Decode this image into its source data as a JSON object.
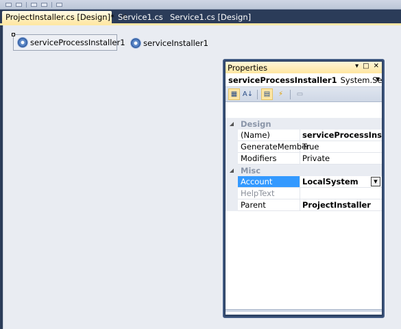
{
  "tabs": [
    {
      "label": "ProjectInstaller.cs [Design]*",
      "active": true
    },
    {
      "label": "Service1.cs",
      "active": false
    },
    {
      "label": "Service1.cs [Design]",
      "active": false
    }
  ],
  "tab_close_glyph": "✕",
  "designer": {
    "components": [
      {
        "label": "serviceProcessInstaller1",
        "icon": "gear-icon",
        "selected": true
      },
      {
        "label": "serviceInstaller1",
        "icon": "gear-icon",
        "selected": false
      }
    ]
  },
  "properties": {
    "title": "Properties",
    "title_buttons": [
      "▾",
      "□",
      "✕"
    ],
    "object_name": "serviceProcessInstaller1",
    "object_type": "System.ServicePro",
    "toolbar": [
      "categorized-icon",
      "alphabetical-icon",
      "properties-icon",
      "events-icon",
      "property-pages-icon"
    ],
    "categories": [
      {
        "name": "Design",
        "rows": [
          {
            "name": "(Name)",
            "value": "serviceProcessInstaller",
            "bold": true
          },
          {
            "name": "GenerateMember",
            "value": "True",
            "bold": false
          },
          {
            "name": "Modifiers",
            "value": "Private",
            "bold": false
          }
        ]
      },
      {
        "name": "Misc",
        "rows": [
          {
            "name": "Account",
            "value": "LocalSystem",
            "bold": true,
            "selected": true,
            "dropdown": true
          },
          {
            "name": "HelpText",
            "value": "",
            "bold": false,
            "disabled": true
          },
          {
            "name": "Parent",
            "value": "ProjectInstaller",
            "bold": true
          }
        ]
      }
    ]
  },
  "colors": {
    "ide_frame": "#2b3c59",
    "active_tab": "#ffe8a6",
    "designer_bg": "#e9ecf2",
    "selection": "#3399ff"
  }
}
